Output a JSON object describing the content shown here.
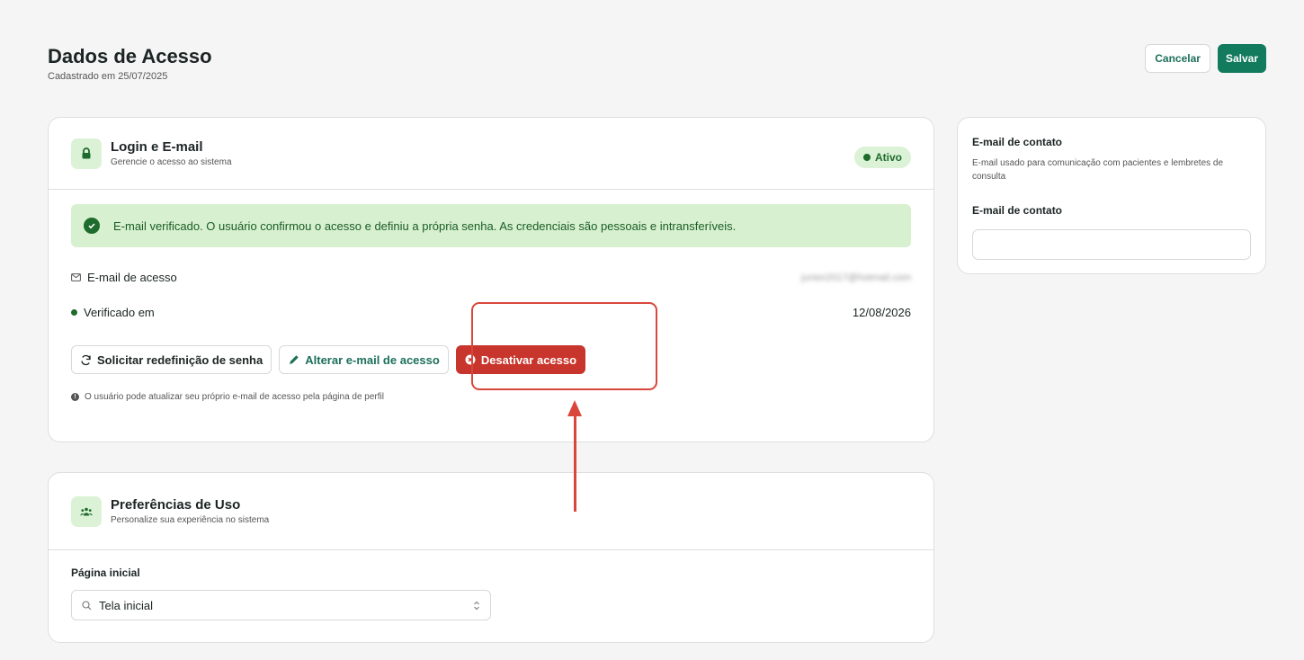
{
  "header": {
    "title": "Dados de Acesso",
    "subtitle": "Cadastrado em 25/07/2025",
    "cancel_label": "Cancelar",
    "save_label": "Salvar"
  },
  "login_card": {
    "title": "Login e E-mail",
    "subtitle": "Gerencie o acesso ao sistema",
    "icon": "lock-icon",
    "status_badge": "Ativo",
    "alert_text": "E-mail verificado. O usuário confirmou o acesso e definiu a própria senha. As credenciais são pessoais e intransferíveis.",
    "email_label": "E-mail de acesso",
    "email_value": "junior2017@hotmail.com",
    "verified_label": "Verificado em",
    "verified_value": "12/08/2026",
    "actions": {
      "reset_password": "Solicitar redefinição de senha",
      "change_email": "Alterar e-mail de acesso",
      "deactivate": "Desativar acesso"
    },
    "hint": "O usuário pode atualizar seu próprio e-mail de acesso pela página de perfil"
  },
  "pref_card": {
    "title": "Preferências de Uso",
    "subtitle": "Personalize sua experiência no sistema",
    "icon": "users-icon",
    "home_label": "Página inicial",
    "home_value": "Tela inicial"
  },
  "contact_card": {
    "title": "E-mail de contato",
    "description": "E-mail usado para comunicação com pacientes e lembretes de consulta",
    "field_label": "E-mail de contato",
    "field_value": ""
  },
  "colors": {
    "accent": "#127a5d",
    "success_bg": "#d7f0cf",
    "danger": "#c7352c",
    "annotation": "#d9473c"
  }
}
